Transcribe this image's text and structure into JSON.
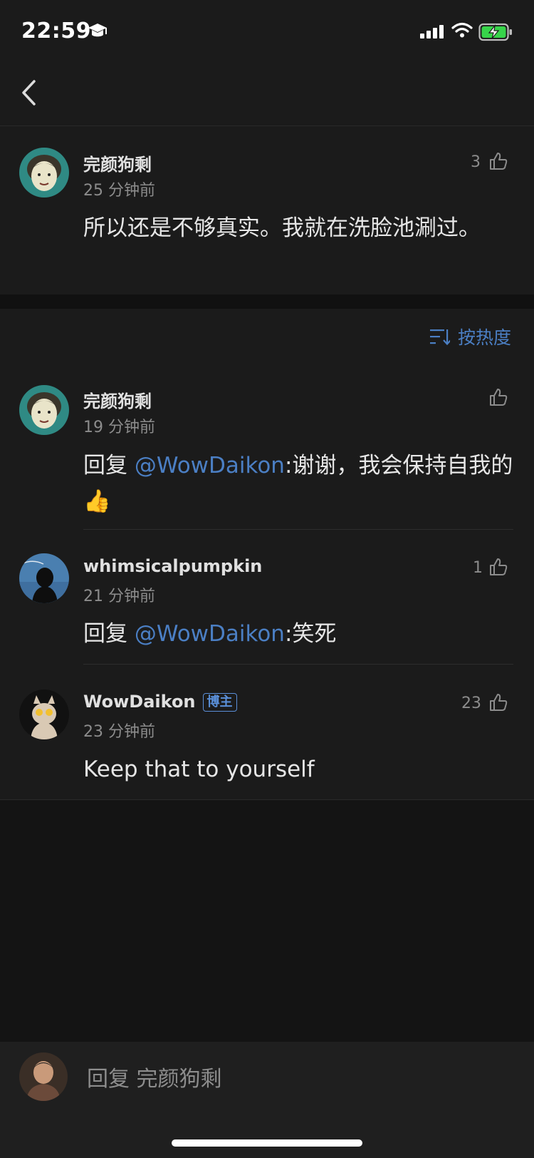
{
  "status_bar": {
    "time": "22:59",
    "icons": [
      "graduation-cap-icon",
      "signal-icon",
      "wifi-icon",
      "battery-charging-icon"
    ]
  },
  "nav": {
    "back_icon": "chevron-left-icon"
  },
  "main_comment": {
    "username": "完颜狗剩",
    "time": "25 分钟前",
    "likes": "3",
    "text": "所以还是不够真实。我就在洗脸池涮过。"
  },
  "sort": {
    "label": "按热度",
    "icon": "sort-lines-icon"
  },
  "replies": [
    {
      "username": "完颜狗剩",
      "time": "19 分钟前",
      "likes": "",
      "prefix": "回复 ",
      "mention": "@WowDaikon",
      "text": ":谢谢，我会保持自我的",
      "emoji": "👍"
    },
    {
      "username": "whimsicalpumpkin",
      "time": "21 分钟前",
      "likes": "1",
      "prefix": "回复 ",
      "mention": "@WowDaikon",
      "text": ":笑死"
    },
    {
      "username": "WowDaikon",
      "badge": "博主",
      "time": "23 分钟前",
      "likes": "23",
      "text": "Keep that to yourself"
    }
  ],
  "input": {
    "placeholder": "回复 完颜狗剩"
  },
  "colors": {
    "accent": "#4b7fc4",
    "background": "#141414",
    "card": "#1b1b1b"
  }
}
